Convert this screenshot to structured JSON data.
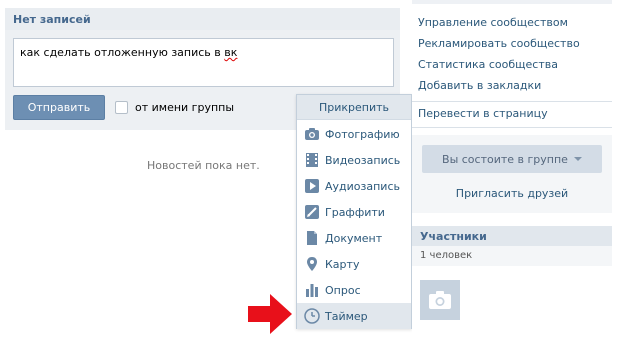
{
  "wall": {
    "header_title": "Нет записей",
    "post_text_before": "как сделать отложенную запись в ",
    "post_text_spell": "вк",
    "send_button": "Отправить",
    "from_group_label": "от имени группы",
    "empty_message": "Новостей пока нет."
  },
  "attach_menu": {
    "title": "Прикрепить",
    "items": [
      {
        "label": "Фотографию",
        "icon": "camera-icon"
      },
      {
        "label": "Видеозапись",
        "icon": "film-icon"
      },
      {
        "label": "Аудиозапись",
        "icon": "play-icon"
      },
      {
        "label": "Граффити",
        "icon": "pen-icon"
      },
      {
        "label": "Документ",
        "icon": "document-icon"
      },
      {
        "label": "Карту",
        "icon": "map-pin-icon"
      },
      {
        "label": "Опрос",
        "icon": "poll-chart-icon"
      },
      {
        "label": "Таймер",
        "icon": "clock-icon",
        "selected": true
      }
    ]
  },
  "sidebar": {
    "links": [
      "Управление сообществом",
      "Рекламировать сообщество",
      "Статистика сообщества",
      "Добавить в закладки"
    ],
    "convert_link": "Перевести в страницу",
    "member_button": "Вы состоите в группе",
    "invite_link": "Пригласить друзей",
    "members_header": "Участники",
    "members_count": "1 человек"
  },
  "colors": {
    "accent": "#2b587a",
    "button_blue": "#6d8fb3",
    "arrow_red": "#e8101a"
  }
}
